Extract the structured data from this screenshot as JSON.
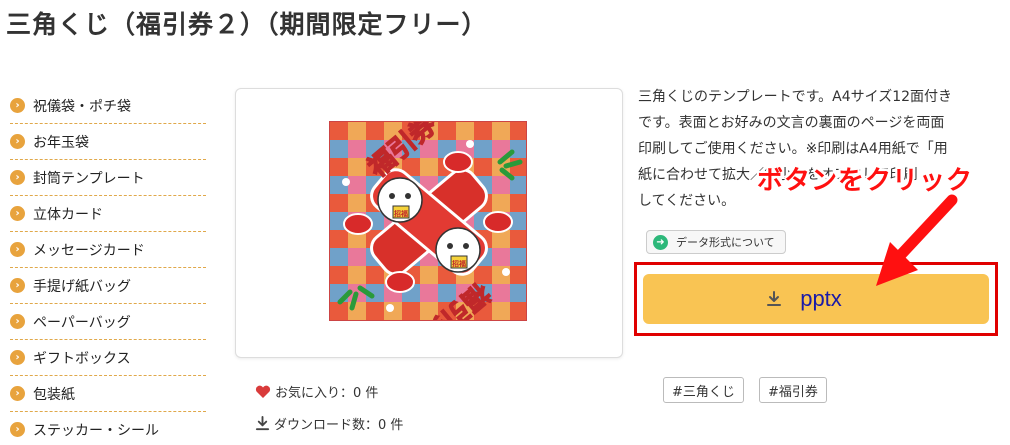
{
  "page": {
    "title": "三角くじ（福引券２）（期間限定フリー）"
  },
  "sidebar": {
    "items": [
      {
        "label": "祝儀袋・ポチ袋",
        "icon": "chevron-right-circle-icon"
      },
      {
        "label": "お年玉袋",
        "icon": "chevron-right-circle-icon"
      },
      {
        "label": "封筒テンプレート",
        "icon": "chevron-right-circle-icon"
      },
      {
        "label": "立体カード",
        "icon": "chevron-right-circle-icon"
      },
      {
        "label": "メッセージカード",
        "icon": "chevron-right-circle-icon"
      },
      {
        "label": "手提げ紙バッグ",
        "icon": "chevron-right-circle-icon"
      },
      {
        "label": "ペーパーバッグ",
        "icon": "chevron-right-circle-icon"
      },
      {
        "label": "ギフトボックス",
        "icon": "chevron-right-circle-icon"
      },
      {
        "label": "包装紙",
        "icon": "chevron-right-circle-icon"
      },
      {
        "label": "ステッカー・シール",
        "icon": "chevron-right-circle-icon"
      }
    ]
  },
  "product": {
    "image_text_top": "福引券",
    "image_text_bottom": "福引券",
    "image_small_label": "招福"
  },
  "description": {
    "line1": "三角くじのテンプレートです。A4サイズ12面付き",
    "line2": "です。表面とお好みの文言の裏面のページを両面",
    "line3": "印刷してご使用ください。※印刷はA4用紙で「用",
    "line4": "紙に合わせて拡大／縮小」をオフにして印刷",
    "line5": "してください。"
  },
  "data_format": {
    "label": "データ形式について",
    "icon": "arrow-right-circle-icon"
  },
  "download": {
    "label": "pptx",
    "icon": "download-icon"
  },
  "annotation": {
    "text": "ボタンをクリック"
  },
  "stats": {
    "favorites_label": "お気に入り：0 件",
    "downloads_label": "ダウンロード数：0 件"
  },
  "tags": [
    {
      "label": "#三角くじ"
    },
    {
      "label": "#福引券"
    }
  ],
  "colors": {
    "accent_orange": "#e8a33d",
    "download_button": "#f9c453",
    "download_text": "#1a1aa8",
    "annotation_red": "#ff1010",
    "data_format_icon": "#2db87a",
    "favorite_heart": "#d93b3b"
  }
}
